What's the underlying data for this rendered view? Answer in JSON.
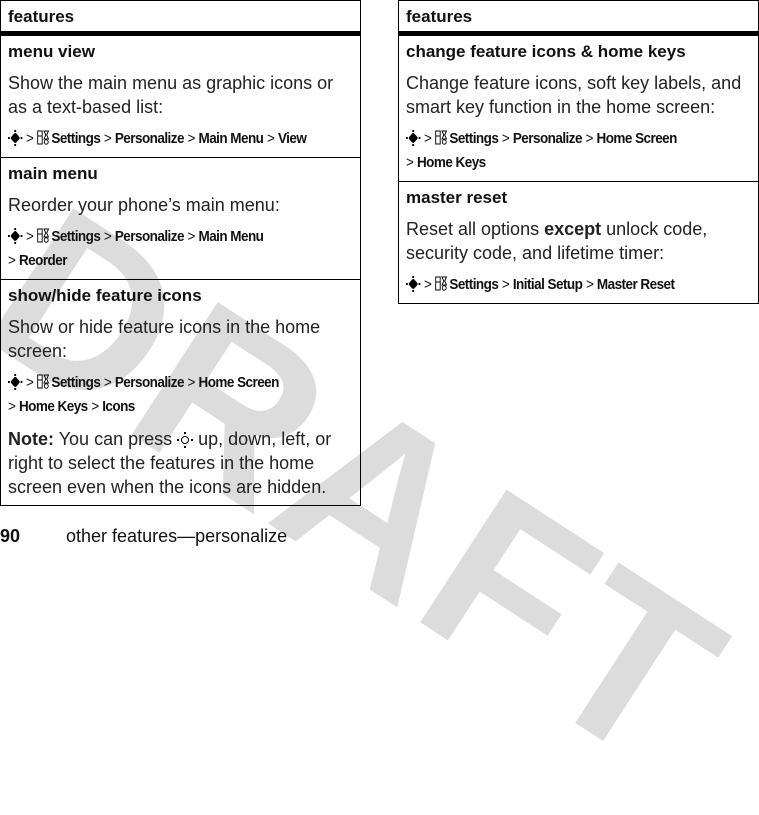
{
  "watermark": "DRAFT",
  "left_table": {
    "header": "features",
    "rows": [
      {
        "title": "menu view",
        "description": "Show the main menu as graphic icons or as a text-based list:",
        "path": [
          "Settings",
          "Personalize",
          "Main Menu",
          "View"
        ]
      },
      {
        "title": "main menu",
        "description": "Reorder your phone’s main menu:",
        "path": [
          "Settings",
          "Personalize",
          "Main Menu",
          "Reorder"
        ]
      },
      {
        "title": "show/hide feature icons",
        "description": "Show or hide feature icons in the home screen:",
        "path": [
          "Settings",
          "Personalize",
          "Home Screen",
          "Home Keys",
          "Icons"
        ],
        "note_label": "Note:",
        "note_pre": "You can press",
        "note_post": "up, down, left, or right to select the features in the home screen even when the icons are hidden."
      }
    ]
  },
  "right_table": {
    "header": "features",
    "rows": [
      {
        "title": "change feature icons & home keys",
        "description": "Change feature icons, soft key labels, and smart key function in the home screen:",
        "path": [
          "Settings",
          "Personalize",
          "Home Screen",
          "Home Keys"
        ]
      },
      {
        "title": "master reset",
        "desc_pre": "Reset all options",
        "desc_bold": "except",
        "desc_post": "unlock code, security code, and lifetime timer:",
        "path": [
          "Settings",
          "Initial Setup",
          "Master Reset"
        ]
      }
    ]
  },
  "footer": {
    "page_number": "90",
    "section": "other features—personalize"
  }
}
